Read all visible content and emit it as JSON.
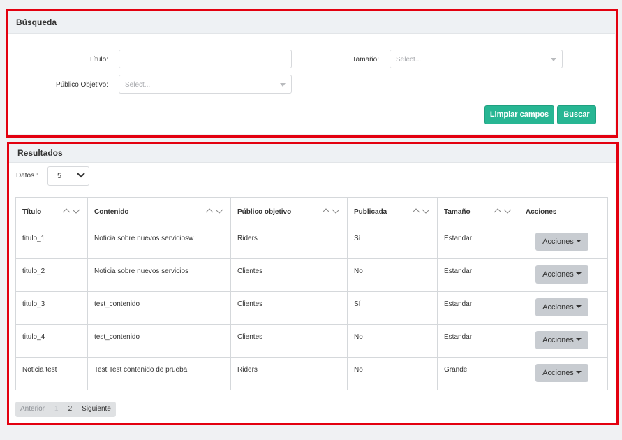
{
  "search": {
    "header": "Búsqueda",
    "titulo_label": "Título:",
    "titulo_value": "",
    "tamano_label": "Tamaño:",
    "tamano_placeholder": "Select...",
    "publico_label": "Público Objetivo:",
    "publico_placeholder": "Select...",
    "clear_label": "Limpiar campos",
    "search_label": "Buscar"
  },
  "results": {
    "header": "Resultados",
    "datos_label": "Datos :",
    "datos_value": "5",
    "columns": [
      "Título",
      "Contenido",
      "Público objetivo",
      "Publicada",
      "Tamaño",
      "Acciones"
    ],
    "rows": [
      {
        "titulo": "titulo_1",
        "contenido": "Noticia sobre nuevos serviciosw",
        "publico": "Riders",
        "publicada": "Sí",
        "tamano": "Estandar",
        "accion": "Acciones"
      },
      {
        "titulo": "titulo_2",
        "contenido": "Noticia sobre nuevos servicios",
        "publico": "Clientes",
        "publicada": "No",
        "tamano": "Estandar",
        "accion": "Acciones"
      },
      {
        "titulo": "titulo_3",
        "contenido": "test_contenido",
        "publico": "Clientes",
        "publicada": "Sí",
        "tamano": "Estandar",
        "accion": "Acciones"
      },
      {
        "titulo": "titulo_4",
        "contenido": "test_contenido",
        "publico": "Clientes",
        "publicada": "No",
        "tamano": "Estandar",
        "accion": "Acciones"
      },
      {
        "titulo": "Noticia test",
        "contenido": "Test Test contenido de prueba",
        "publico": "Riders",
        "publicada": "No",
        "tamano": "Grande",
        "accion": "Acciones"
      }
    ],
    "pagination": {
      "prev": "Anterior",
      "pages": [
        "1",
        "2"
      ],
      "current": "1",
      "next": "Siguiente"
    }
  },
  "colors": {
    "accent_green": "#27b693",
    "highlight_red": "#e3000f",
    "header_bg": "#eef1f4"
  }
}
